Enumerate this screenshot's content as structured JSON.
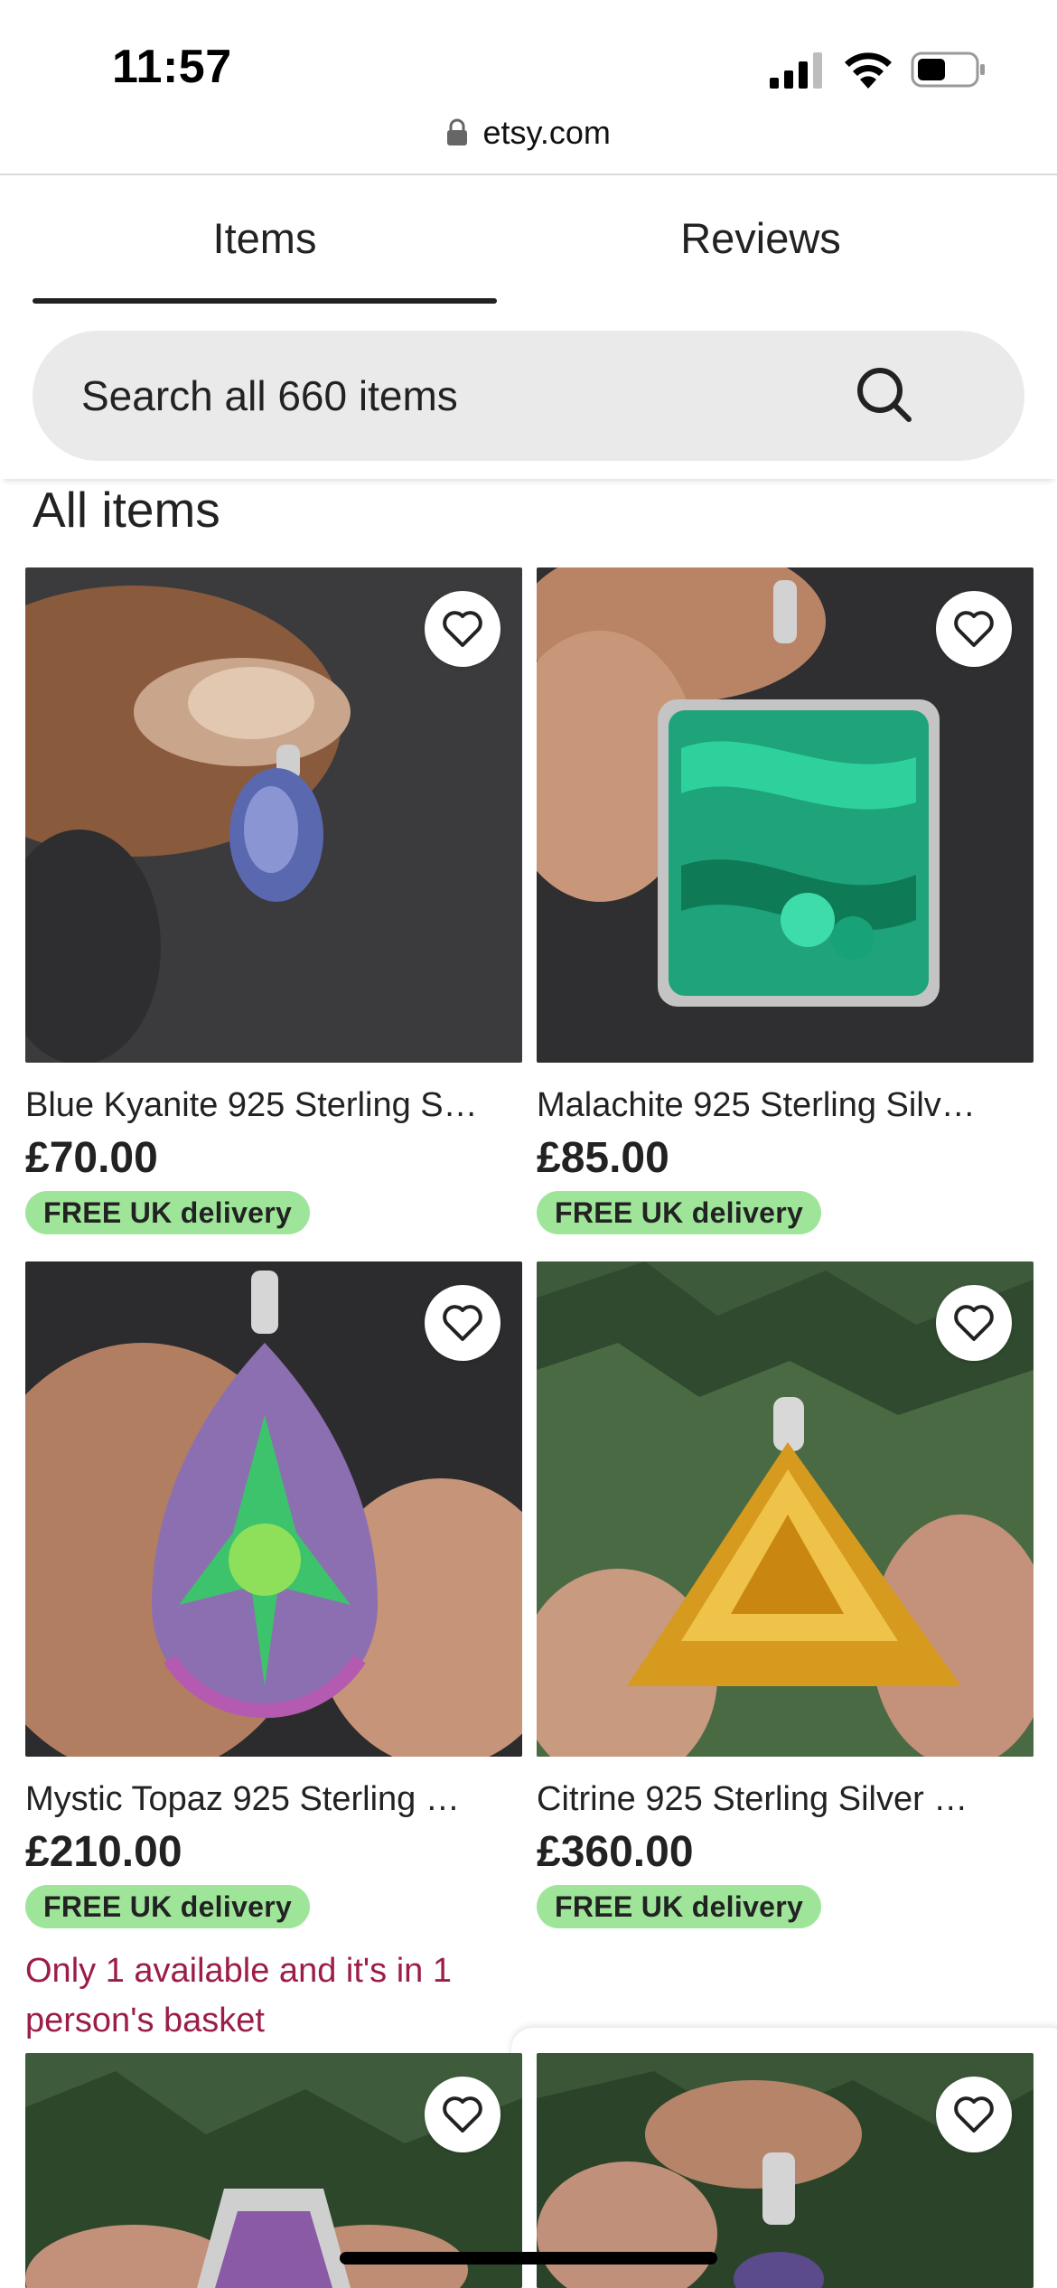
{
  "status_bar": {
    "time": "11:57",
    "icons": [
      "cellular-signal-icon",
      "wifi-icon",
      "battery-icon"
    ]
  },
  "browser": {
    "url": "etsy.com",
    "lock_icon": "lock-icon"
  },
  "tabs": [
    {
      "label": "Items",
      "active": true
    },
    {
      "label": "Reviews",
      "active": false
    }
  ],
  "search": {
    "placeholder": "Search all 660 items",
    "icon": "search-icon"
  },
  "section_title": "All items",
  "colors": {
    "badge_green": "#9ee59a",
    "scarcity_text": "#9b1d48",
    "search_bg": "#eaeaea",
    "text": "#222222"
  },
  "products": [
    {
      "title": "Blue Kyanite 925 Sterling S…",
      "price": "£70.00",
      "badge": "FREE UK delivery",
      "image": "blue kyanite pendant held in fingers",
      "favorited": false
    },
    {
      "title": "Malachite 925 Sterling Silv…",
      "price": "£85.00",
      "badge": "FREE UK delivery",
      "image": "green malachite rectangular pendant",
      "favorited": false
    },
    {
      "title": "Mystic Topaz 925 Sterling …",
      "price": "£210.00",
      "badge": "FREE UK delivery",
      "scarcity": "Only 1 available and it's in 1 person's basket",
      "image": "mystic topaz teardrop pendant",
      "favorited": false
    },
    {
      "title": "Citrine 925 Sterling Silver …",
      "price": "£360.00",
      "badge": "FREE UK delivery",
      "image": "citrine triangular pendant",
      "favorited": false
    },
    {
      "image": "gemstone pendant with pine tree background",
      "favorited": false
    },
    {
      "image": "gemstone pendant with pine tree background",
      "favorited": false
    }
  ]
}
